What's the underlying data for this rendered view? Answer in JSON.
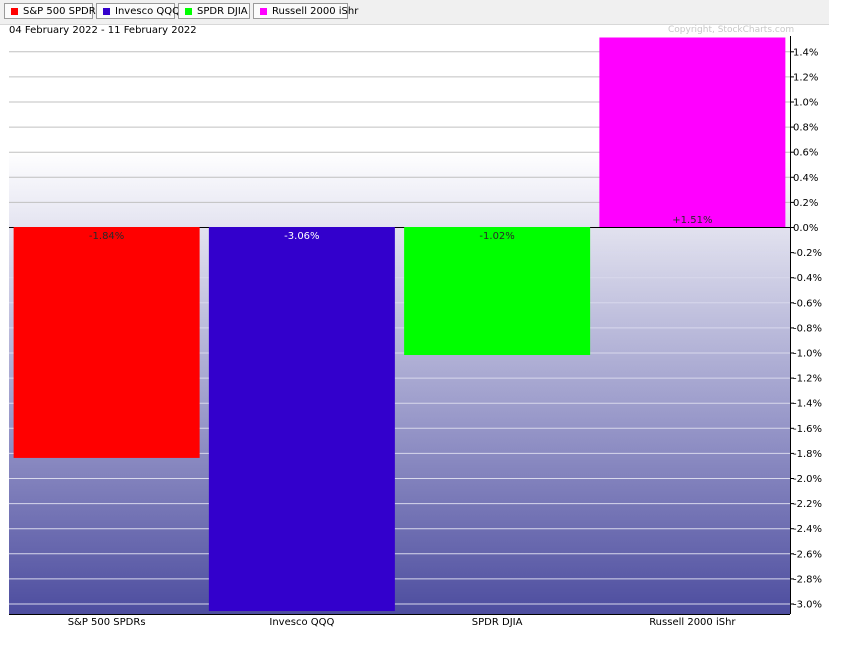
{
  "legend": [
    {
      "label": "S&P 500 SPDRs",
      "color": "#ff0000"
    },
    {
      "label": "Invesco QQQ",
      "color": "#3300cc"
    },
    {
      "label": "SPDR DJIA",
      "color": "#00ff00"
    },
    {
      "label": "Russell 2000 iShr",
      "color": "#ff00ff"
    }
  ],
  "date_range": "04 February 2022 - 11 February 2022",
  "copyright": "Copyright, StockCharts.com",
  "chart_data": {
    "type": "bar",
    "title": "",
    "xlabel": "",
    "ylabel": "",
    "ylim": [
      -3.06,
      1.51
    ],
    "grid": true,
    "legend_position": "top-left",
    "categories": [
      "S&P 500 SPDRs",
      "Invesco QQQ",
      "SPDR DJIA",
      "Russell 2000 iShr"
    ],
    "values": [
      -1.84,
      -3.06,
      -1.02,
      1.51
    ],
    "data_labels": [
      "-1.84%",
      "-3.06%",
      "-1.02%",
      "+1.51%"
    ],
    "colors": [
      "#ff0000",
      "#3300cc",
      "#00ff00",
      "#ff00ff"
    ],
    "y_ticks": [
      1.4,
      1.2,
      1.0,
      0.8,
      0.6,
      0.4,
      0.2,
      0.0,
      -0.2,
      -0.4,
      -0.6,
      -0.8,
      -1.0,
      -1.2,
      -1.4,
      -1.6,
      -1.8,
      -2.0,
      -2.2,
      -2.4,
      -2.6,
      -2.8,
      -3.0
    ],
    "y_tick_labels": [
      "1.4%",
      "1.2%",
      "1.0%",
      "0.8%",
      "0.6%",
      "0.4%",
      "0.2%",
      "0.0%",
      "-0.2%",
      "-0.4%",
      "-0.6%",
      "-0.8%",
      "-1.0%",
      "-1.2%",
      "-1.4%",
      "-1.6%",
      "-1.8%",
      "-2.0%",
      "-2.2%",
      "-2.4%",
      "-2.6%",
      "-2.8%",
      "-3.0%"
    ]
  }
}
